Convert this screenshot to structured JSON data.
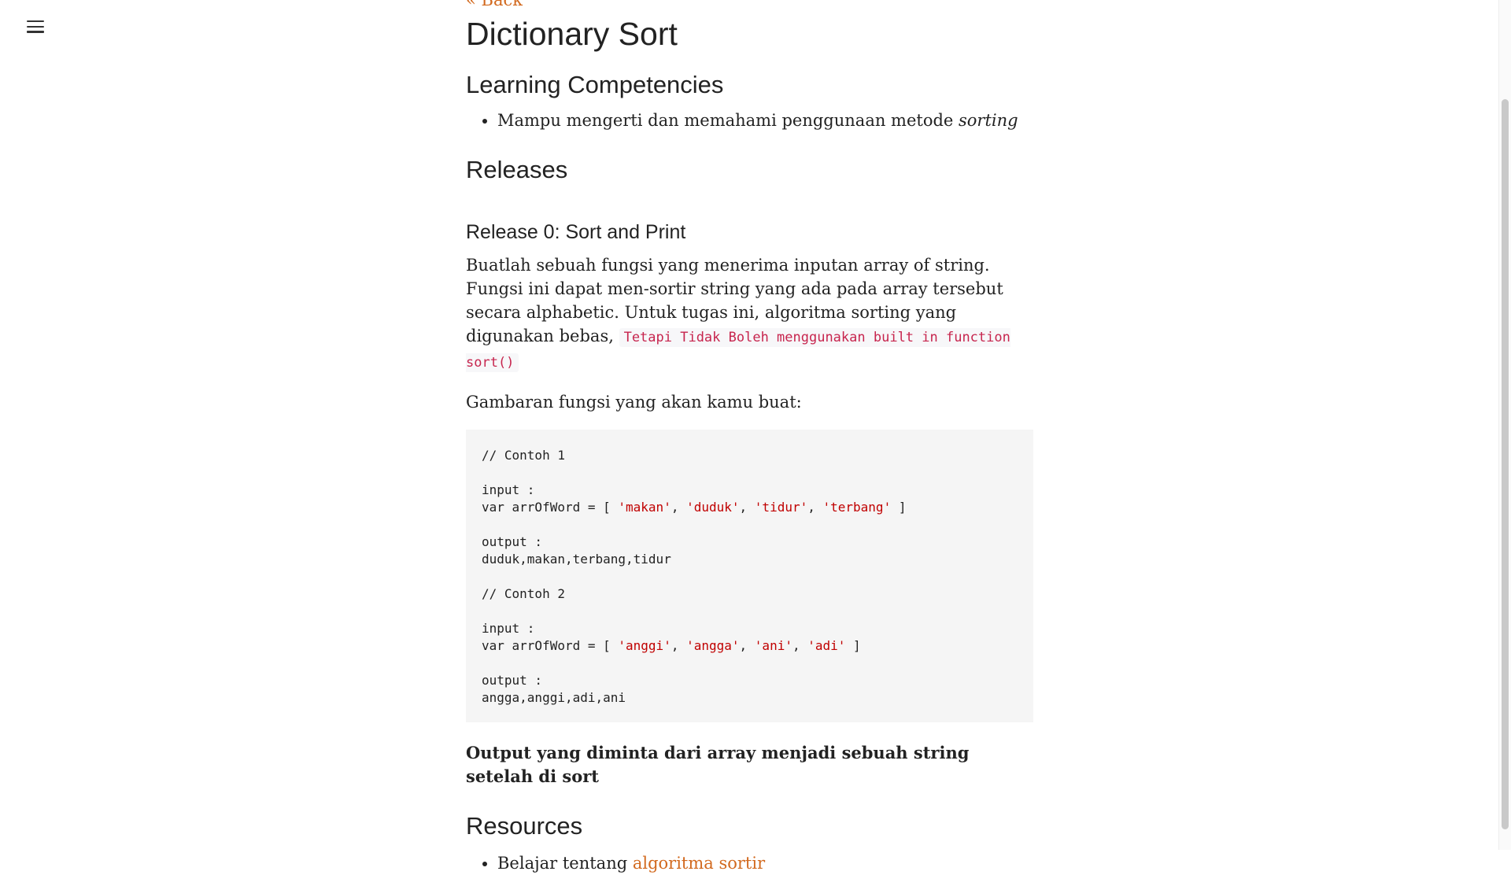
{
  "nav": {
    "back_label": "« Back"
  },
  "page": {
    "title": "Dictionary Sort",
    "competencies_heading": "Learning Competencies",
    "competency_text": "Mampu mengerti dan memahami penggunaan metode ",
    "competency_em": "sorting",
    "releases_heading": "Releases",
    "release0_heading": "Release 0: Sort and Print",
    "release0_desc": "Buatlah sebuah fungsi yang menerima inputan array of string. Fungsi ini dapat men-sortir string yang ada pada array tersebut secara alphabetic. Untuk tugas ini, algoritma sorting yang digunakan bebas, ",
    "release0_code": "Tetapi Tidak Boleh menggunakan built in function sort()",
    "gambaran": "Gambaran fungsi yang akan kamu buat:",
    "code_block": {
      "comment1": "// Contoh 1",
      "input_label": "input :",
      "var_prefix": "var arrOfWord = [ ",
      "example1_words": [
        "'makan'",
        "'duduk'",
        "'tidur'",
        "'terbang'"
      ],
      "output_label": "output :",
      "example1_output": "duduk,makan,terbang,tidur",
      "comment2": "// Contoh 2",
      "example2_words": [
        "'anggi'",
        "'angga'",
        "'ani'",
        "'adi'"
      ],
      "example2_output": "angga,anggi,adi,ani",
      "separator": ", ",
      "close": " ]"
    },
    "output_note": "Output yang diminta dari array menjadi sebuah string setelah di sort",
    "resources_heading": "Resources",
    "resource_text": "Belajar tentang ",
    "resource_link": "algoritma sortir"
  },
  "colors": {
    "link": "#d2691e",
    "inline_code": "#c7254e",
    "code_string": "#c00000",
    "code_bg": "#f5f5f5"
  },
  "icons": {
    "menu": "hamburger-menu-icon"
  }
}
